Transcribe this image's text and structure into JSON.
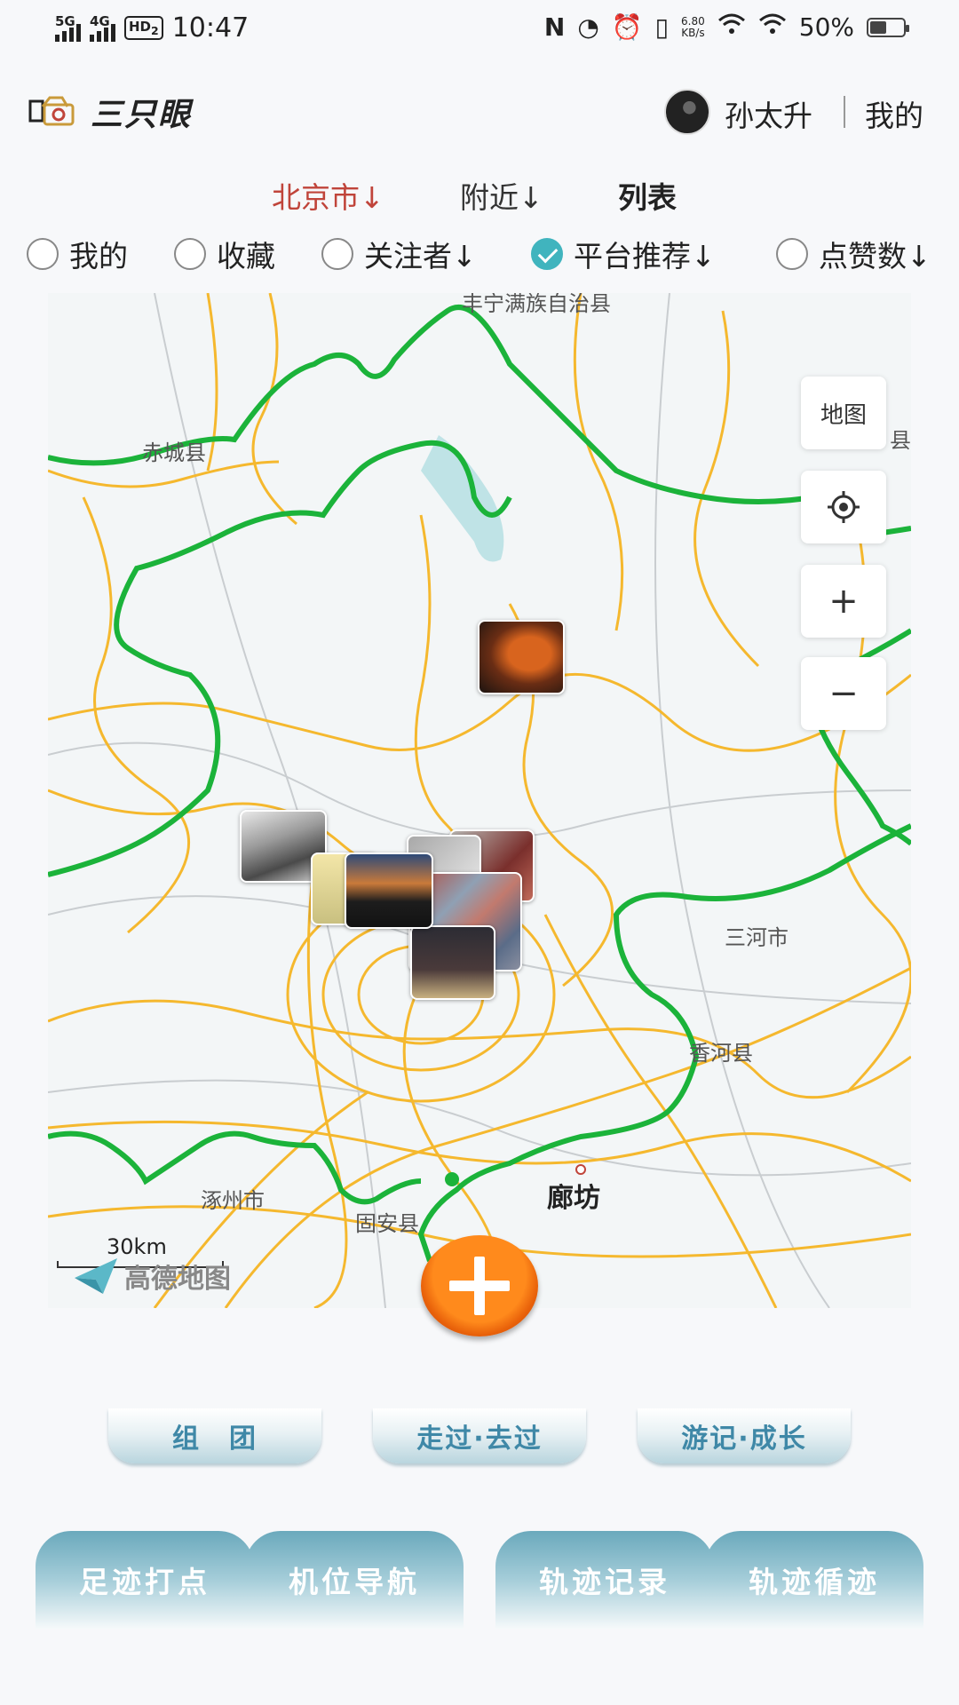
{
  "status_bar": {
    "signal1": "5G",
    "signal2": "4G",
    "hd_label": "HD",
    "hd_sub": "2",
    "time": "10:47",
    "net_rate": "6.80",
    "net_unit": "KB/s",
    "battery": "50%",
    "battery_level": 0.5
  },
  "header": {
    "app_title": "三只眼",
    "user_name": "孙太升",
    "my_link": "我的"
  },
  "filters": {
    "city": "北京市↓",
    "nearby": "附近↓",
    "list": "列表"
  },
  "radio_options": [
    {
      "label": "我的",
      "checked": false
    },
    {
      "label": "收藏",
      "checked": false
    },
    {
      "label": "关注者↓",
      "checked": false
    },
    {
      "label": "平台推荐↓",
      "checked": true
    },
    {
      "label": "点赞数↓",
      "checked": false
    }
  ],
  "map": {
    "labels": {
      "top": "丰宁满族自治县",
      "chicheng": "赤城县",
      "right_edge": "县",
      "sanhe": "三河市",
      "xianghe": "香河县",
      "zhuozhou": "涿州市",
      "guan": "固安县",
      "langfang": "廊坊"
    },
    "controls": {
      "map_type": "地图",
      "zoom_in": "+",
      "zoom_out": "−"
    },
    "scale_label": "30km",
    "provider": "高德地图"
  },
  "action_buttons": [
    "组　团",
    "走过·去过",
    "游记·成长"
  ],
  "bottom_tabs": [
    "足迹打点",
    "机位导航",
    "轨迹记录",
    "轨迹循迹"
  ],
  "colors": {
    "accent_red": "#c0443a",
    "teal": "#40b4be",
    "button_text": "#3f88a7",
    "boundary_green": "#1bb33a",
    "road_yellow": "#f5b82e",
    "fab_orange": "#ff8a1c"
  }
}
